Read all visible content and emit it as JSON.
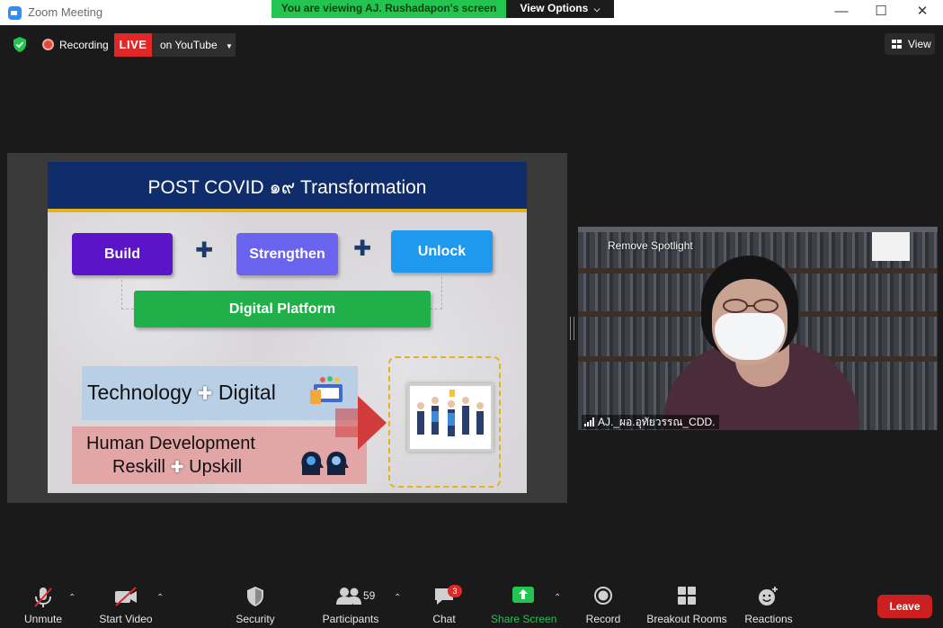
{
  "window": {
    "title": "Zoom Meeting",
    "banner_text": "You are viewing AJ. Rushadapon's screen",
    "view_options": "View Options",
    "minimize": "—",
    "maximize": "☐",
    "close": "✕"
  },
  "topbar": {
    "recording_label": "Recording",
    "live_label": "LIVE",
    "youtube_label": "on YouTube",
    "view_label": "View",
    "accent_green": "#23c551",
    "live_red": "#e02828"
  },
  "slide": {
    "title": "POST COVID ๑๙ Transformation",
    "build": "Build",
    "strengthen": "Strengthen",
    "unlock": "Unlock",
    "digital_platform": "Digital Platform",
    "technology": "Technology",
    "digital": "Digital",
    "human_development": "Human Development",
    "reskill": "Reskill",
    "upskill": "Upskill"
  },
  "video": {
    "remove_spotlight": "Remove Spotlight",
    "participant_name": "AJ._ผอ.อุทัยวรรณ_CDD."
  },
  "toolbar": {
    "unmute": "Unmute",
    "start_video": "Start Video",
    "security": "Security",
    "participants": "Participants",
    "participants_count": "59",
    "chat": "Chat",
    "chat_badge": "3",
    "share_screen": "Share Screen",
    "record": "Record",
    "breakout_rooms": "Breakout Rooms",
    "reactions": "Reactions",
    "leave": "Leave"
  }
}
